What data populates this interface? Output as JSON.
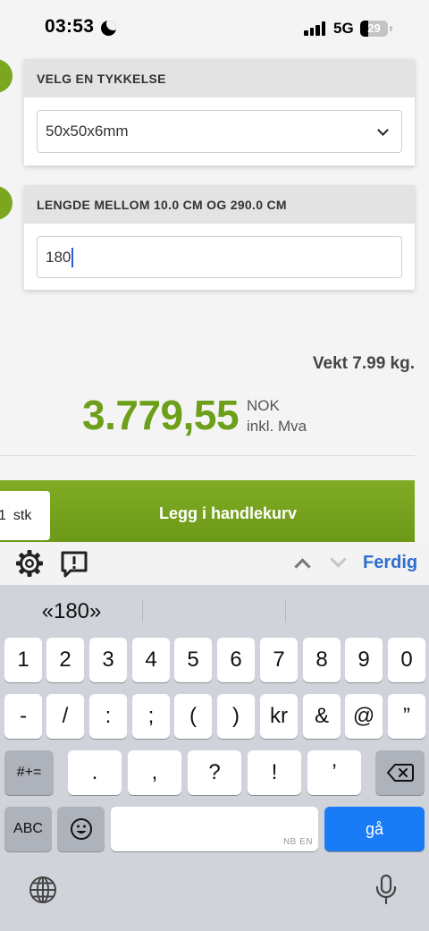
{
  "status_bar": {
    "time": "03:53",
    "network": "5G",
    "battery": "29",
    "battery_level_percent": 29
  },
  "options": {
    "thickness": {
      "header": "VELG EN TYKKELSE",
      "selected_value": "50x50x6mm"
    },
    "length": {
      "header": "LENGDE MELLOM 10.0 CM OG 290.0 CM",
      "input_value": "180"
    }
  },
  "summary": {
    "weight": "Vekt 7.99 kg.",
    "price": "3.779,55",
    "currency": "NOK",
    "vat_note": "inkl. Mva"
  },
  "cart": {
    "quantity": "1",
    "unit": "stk",
    "add_button_label": "Legg i handlekurv",
    "button_color": "#7aa620"
  },
  "keyboard_toolbar": {
    "done_label": "Ferdig",
    "icons": [
      "gear-icon",
      "feedback-icon",
      "chevron-up-icon",
      "chevron-down-icon"
    ]
  },
  "keyboard": {
    "suggestion": "«180»",
    "row1": [
      "1",
      "2",
      "3",
      "4",
      "5",
      "6",
      "7",
      "8",
      "9",
      "0"
    ],
    "row2": [
      "-",
      "/",
      ":",
      ";",
      "(",
      ")",
      "kr",
      "&",
      "@",
      "”"
    ],
    "row3": [
      ".",
      ",",
      "?",
      "!",
      "’"
    ],
    "symbols_key": "#+=",
    "abc_key": "ABC",
    "go_key": "gå",
    "space_hint": "NB EN",
    "accent_color": "#1a7bf7"
  }
}
